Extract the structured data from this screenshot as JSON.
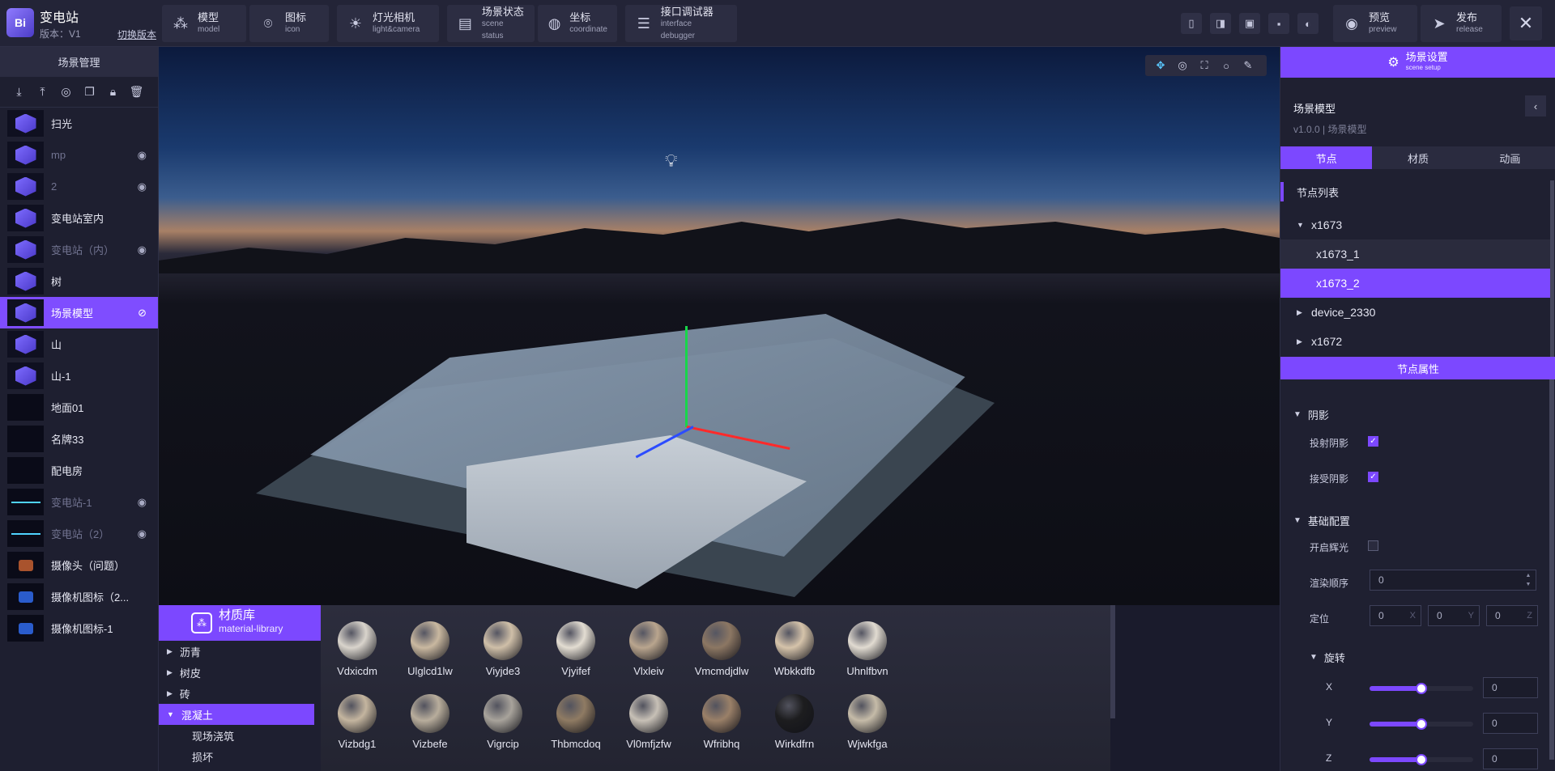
{
  "app": {
    "title": "变电站",
    "version": "版本：V1",
    "switch_version": "切换版本",
    "logo_text": "Bi"
  },
  "toolbar": [
    {
      "zh": "模型",
      "en": "model",
      "icon": "cubes-icon"
    },
    {
      "zh": "图标",
      "en": "icon",
      "icon": "location-pin-icon"
    },
    {
      "zh": "灯光相机",
      "en": "light&camera",
      "icon": "light-icon"
    },
    {
      "zh": "场景状态",
      "en": "scene status",
      "icon": "window-icon"
    },
    {
      "zh": "坐标",
      "en": "coordinate",
      "icon": "globe-icon"
    },
    {
      "zh": "接口调试器",
      "en": "interface debugger",
      "icon": "sliders-icon"
    }
  ],
  "top_right": {
    "preview_zh": "预览",
    "preview_en": "preview",
    "release_zh": "发布",
    "release_en": "release"
  },
  "left_panel": {
    "title": "场景管理",
    "layers": [
      {
        "name": "扫光",
        "thumb": "cube",
        "visible": true
      },
      {
        "name": "mp",
        "thumb": "cube",
        "visible": false
      },
      {
        "name": "2",
        "thumb": "cube",
        "visible": false
      },
      {
        "name": "变电站室内",
        "thumb": "cube",
        "visible": true
      },
      {
        "name": "变电站（内）",
        "thumb": "cube",
        "visible": false
      },
      {
        "name": "树",
        "thumb": "cube",
        "visible": true
      },
      {
        "name": "场景模型",
        "thumb": "cube",
        "visible": true,
        "active": true
      },
      {
        "name": "山",
        "thumb": "cube",
        "visible": true
      },
      {
        "name": "山-1",
        "thumb": "cube",
        "visible": true
      },
      {
        "name": "地面01",
        "thumb": "dark",
        "visible": true
      },
      {
        "name": "名牌33",
        "thumb": "dark",
        "visible": true
      },
      {
        "name": "配电房",
        "thumb": "dark",
        "visible": true
      },
      {
        "name": "变电站-1",
        "thumb": "line",
        "visible": false
      },
      {
        "name": "变电站（2）",
        "thumb": "line",
        "visible": false
      },
      {
        "name": "摄像头（问题）",
        "thumb": "cam",
        "visible": true
      },
      {
        "name": "摄像机图标（2...",
        "thumb": "cam-blue",
        "visible": true
      },
      {
        "name": "摄像机图标-1",
        "thumb": "cam-blue",
        "visible": true
      }
    ]
  },
  "material_library": {
    "title_zh": "材质库",
    "title_en": "material-library",
    "categories": [
      {
        "name": "沥青",
        "level": 0,
        "expanded": false
      },
      {
        "name": "树皮",
        "level": 0,
        "expanded": false
      },
      {
        "name": "砖",
        "level": 0,
        "expanded": false
      },
      {
        "name": "混凝土",
        "level": 0,
        "expanded": true,
        "active": true
      },
      {
        "name": "现场浇筑",
        "level": 1
      },
      {
        "name": "损坏",
        "level": 1
      }
    ],
    "materials": [
      {
        "name": "Vdxicdm",
        "color": "#d9d4cc"
      },
      {
        "name": "Ulglcd1lw",
        "color": "#c9b8a0"
      },
      {
        "name": "Viyjde3",
        "color": "#cfbfa8"
      },
      {
        "name": "Vjyifef",
        "color": "#e3ddd2"
      },
      {
        "name": "Vlxleiv",
        "color": "#b9a58e"
      },
      {
        "name": "Vmcmdjdlw",
        "color": "#8c7763"
      },
      {
        "name": "Wbkkdfb",
        "color": "#d5c3aa"
      },
      {
        "name": "Uhnlfbvn",
        "color": "#e1dbd1"
      },
      {
        "name": "Vizbdg1",
        "color": "#c4b59f"
      },
      {
        "name": "Vizbefe",
        "color": "#b8ad9c"
      },
      {
        "name": "Vigrcip",
        "color": "#a8a39b"
      },
      {
        "name": "Thbmcdoq",
        "color": "#8f7b63"
      },
      {
        "name": "Vl0mfjzfw",
        "color": "#c7c0b6"
      },
      {
        "name": "Wfribhq",
        "color": "#9a8068"
      },
      {
        "name": "Wirkdfrn",
        "color": "#1d1d1f"
      },
      {
        "name": "Wjwkfga",
        "color": "#c5bba8"
      }
    ]
  },
  "right_panel": {
    "header_zh": "场景设置",
    "header_en": "scene setup",
    "scene_title": "场景模型",
    "scene_sub": "v1.0.0 | 场景模型",
    "tabs": [
      {
        "label": "节点",
        "active": true
      },
      {
        "label": "材质",
        "active": false
      },
      {
        "label": "动画",
        "active": false
      }
    ],
    "node_list_label": "节点列表",
    "nodes": [
      {
        "name": "x1673",
        "kind": "root",
        "expanded": true
      },
      {
        "name": "x1673_1",
        "kind": "child"
      },
      {
        "name": "x1673_2",
        "kind": "child",
        "active": true
      },
      {
        "name": "device_2330",
        "kind": "root",
        "expanded": false
      },
      {
        "name": "x1672",
        "kind": "root",
        "expanded": false
      }
    ],
    "props_title": "节点属性",
    "shadow_group": "阴影",
    "cast_shadow": "投射阴影",
    "receive_shadow": "接受阴影",
    "base_group": "基础配置",
    "glow": "开启辉光",
    "render_order_label": "渲染顺序",
    "render_order_value": "0",
    "position_label": "定位",
    "position": [
      {
        "value": "0",
        "axis": "X"
      },
      {
        "value": "0",
        "axis": "Y"
      },
      {
        "value": "0",
        "axis": "Z"
      }
    ],
    "rotation_group": "旋转",
    "rotation": [
      {
        "axis": "X",
        "value": "0",
        "level": 0.5
      },
      {
        "axis": "Y",
        "value": "0",
        "level": 0.5
      },
      {
        "axis": "Z",
        "value": "0",
        "level": 0.5
      }
    ]
  }
}
